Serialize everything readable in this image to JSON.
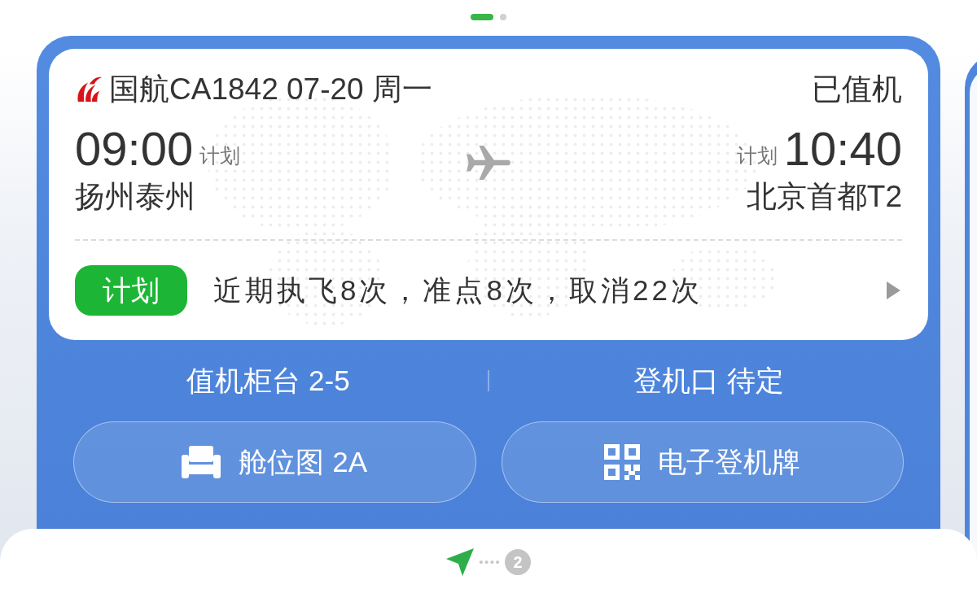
{
  "pager": {
    "dots": [
      {
        "selected": true
      },
      {
        "selected": false
      }
    ]
  },
  "flight_card": {
    "flight": "国航CA1842 07-20 周一",
    "status": "已值机",
    "departure": {
      "time": "09:00",
      "time_type": "计划",
      "airport": "扬州泰州"
    },
    "arrival": {
      "time_type": "计划",
      "time": "10:40",
      "airport": "北京首都T2"
    },
    "history": {
      "tag": "计划",
      "summary": "近期执飞8次，准点8次，取消22次"
    }
  },
  "info": [
    "值机柜台 2-5",
    "登机口 待定"
  ],
  "buttons": [
    {
      "kind": "seat_map",
      "label": "舱位图 2A"
    },
    {
      "kind": "boarding_pass",
      "label": "电子登机牌"
    }
  ],
  "bottom_sheet": {
    "step": "2"
  }
}
